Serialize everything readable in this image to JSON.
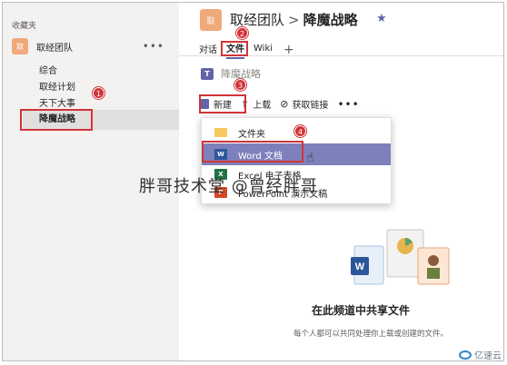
{
  "sidebar": {
    "favorites_label": "收藏夹",
    "team": {
      "avatar": "取",
      "name": "取经团队",
      "more": "•••"
    },
    "channels": [
      {
        "label": "综合"
      },
      {
        "label": "取经计划"
      },
      {
        "label": "天下大事"
      },
      {
        "label": "降魔战略"
      }
    ]
  },
  "header": {
    "avatar": "取",
    "team": "取经团队",
    "separator": ">",
    "channel": "降魔战略",
    "star": "★"
  },
  "tabs": [
    {
      "label": "对话"
    },
    {
      "label": "文件"
    },
    {
      "label": "Wiki"
    }
  ],
  "tab_add": "+",
  "files": {
    "icon": "T",
    "title": "降魔战略"
  },
  "toolbar": {
    "new_label": "新建",
    "upload_icon": "⇧",
    "upload_label": "上载",
    "link_icon": "⊘",
    "link_label": "获取链接",
    "more": "•••"
  },
  "menu": {
    "items": [
      {
        "label": "文件夹"
      },
      {
        "icon": "W",
        "label": "Word 文档"
      },
      {
        "icon": "X",
        "label": "Excel 电子表格"
      },
      {
        "icon": "P",
        "label": "PowerPoint 演示文稿"
      }
    ]
  },
  "annotations": [
    "1",
    "2",
    "3",
    "4"
  ],
  "watermark": "胖哥技术堂 @曾经胖哥",
  "empty_state": {
    "title": "在此频道中共享文件",
    "description": "每个人都可以共同处理你上载或创建的文件。"
  },
  "brand": "亿速云",
  "colors": {
    "accent": "#6264a7",
    "annotation": "#d13438",
    "menu_highlight": "#7e80bb",
    "word": "#2b579a",
    "excel": "#217346",
    "powerpoint": "#d24726",
    "avatar": "#f0a97a"
  }
}
